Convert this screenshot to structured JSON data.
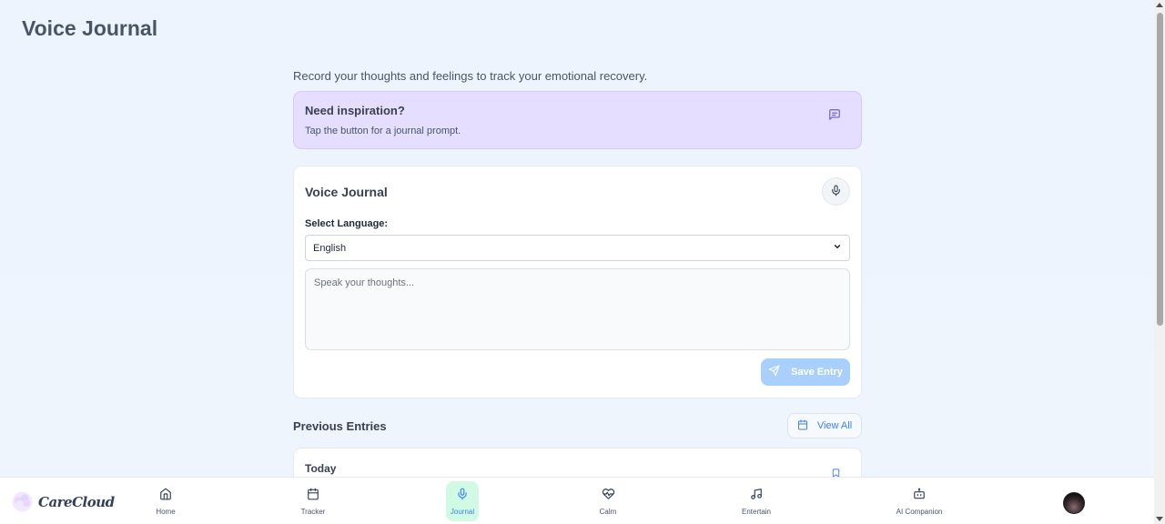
{
  "page": {
    "title": "Voice Journal",
    "subtitle": "Record your thoughts and feelings to track your emotional recovery."
  },
  "inspiration": {
    "title": "Need inspiration?",
    "text": "Tap the button for a journal prompt.",
    "icon": "message-square-icon"
  },
  "voice_card": {
    "title": "Voice Journal",
    "mic_icon": "microphone-icon",
    "language_label": "Select Language:",
    "language_selected": "English",
    "input_placeholder": "Speak your thoughts...",
    "input_value": "",
    "save_label": "Save Entry",
    "save_icon": "send-icon"
  },
  "previous": {
    "title": "Previous Entries",
    "view_all_label": "View All",
    "entries": [
      {
        "date": "Today"
      }
    ]
  },
  "nav": {
    "brand": "CareCloud",
    "items": [
      {
        "label": "Home",
        "icon": "home-icon"
      },
      {
        "label": "Tracker",
        "icon": "calendar-icon"
      },
      {
        "label": "Journal",
        "icon": "microphone-icon",
        "active": true
      },
      {
        "label": "Calm",
        "icon": "heart-pulse-icon"
      },
      {
        "label": "Entertain",
        "icon": "music-icon"
      },
      {
        "label": "AI Companion",
        "icon": "bot-icon"
      }
    ]
  },
  "colors": {
    "accent": "#3b82f6",
    "inspiration_bg": "#e6deff",
    "save_button": "#a9d0fb",
    "active_nav_bg": "#d1fae5"
  }
}
